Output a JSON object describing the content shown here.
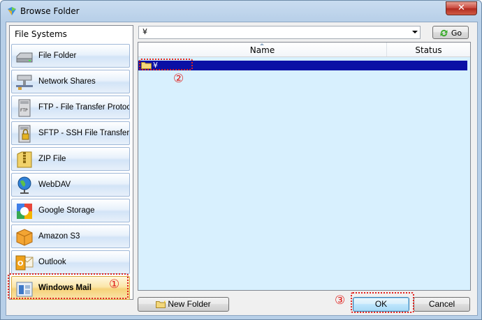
{
  "window": {
    "title": "Browse Folder",
    "close_label": "✕"
  },
  "sidebar": {
    "header": "File Systems",
    "items": [
      {
        "label": "File Folder",
        "icon": "drive-icon"
      },
      {
        "label": "Network Shares",
        "icon": "network-icon"
      },
      {
        "label": "FTP - File Transfer Protocol",
        "icon": "ftp-icon"
      },
      {
        "label": "SFTP - SSH File Transfer Protocol",
        "icon": "sftp-icon"
      },
      {
        "label": "ZIP File",
        "icon": "zip-icon"
      },
      {
        "label": "WebDAV",
        "icon": "globe-icon"
      },
      {
        "label": "Google Storage",
        "icon": "google-icon"
      },
      {
        "label": "Amazon S3",
        "icon": "box-icon"
      },
      {
        "label": "Outlook",
        "icon": "outlook-icon"
      },
      {
        "label": "Windows Mail",
        "icon": "mail-icon",
        "selected": true
      }
    ]
  },
  "path": {
    "value": "¥"
  },
  "go_button": {
    "label": "Go"
  },
  "file_list": {
    "columns": [
      "Name",
      "Status"
    ],
    "rows": [
      {
        "name": "¥",
        "icon": "folder-icon",
        "selected": true
      }
    ]
  },
  "buttons": {
    "new_folder": "New Folder",
    "ok": "OK",
    "cancel": "Cancel"
  },
  "annotations": {
    "one": "①",
    "two": "②",
    "three": "③"
  },
  "colors": {
    "selection": "#0a10a5",
    "annotation": "#e0201c",
    "list_bg": "#d8f0fe"
  }
}
